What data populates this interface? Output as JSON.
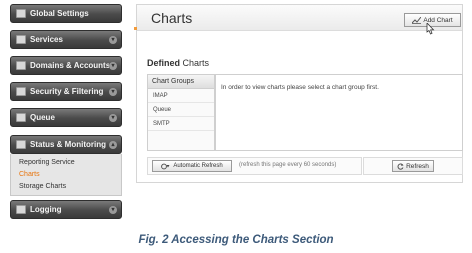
{
  "sidebar": {
    "items": [
      {
        "label": "Global Settings",
        "icon": "globe-icon"
      },
      {
        "label": "Services",
        "icon": "services-icon"
      },
      {
        "label": "Domains & Accounts",
        "icon": "domains-icon"
      },
      {
        "label": "Security & Filtering",
        "icon": "security-icon"
      },
      {
        "label": "Queue",
        "icon": "queue-icon"
      },
      {
        "label": "Status & Monitoring",
        "icon": "monitoring-icon"
      },
      {
        "label": "Logging",
        "icon": "logging-icon"
      }
    ],
    "submenu": [
      "Reporting Service",
      "Charts",
      "Storage Charts"
    ],
    "active_submenu": "Charts"
  },
  "header": {
    "title": "Charts",
    "add_chart_label": "Add Chart"
  },
  "main": {
    "section_title_lead": "Defined",
    "section_title_rest": " Charts",
    "groups_header": "Chart Groups",
    "groups": [
      "IMAP",
      "Queue",
      "SMTP"
    ],
    "message": "In order to view charts please select a chart group first.",
    "auto_refresh_label": "Automatic Refresh",
    "refresh_hint": "(refresh this page every 60 seconds)",
    "refresh_label": "Refresh"
  },
  "caption": "Fig. 2 Accessing the Charts Section",
  "colors": {
    "accent": "#e8740c",
    "nav_dark": "#4a4a4a",
    "caption": "#3d5a7a"
  }
}
